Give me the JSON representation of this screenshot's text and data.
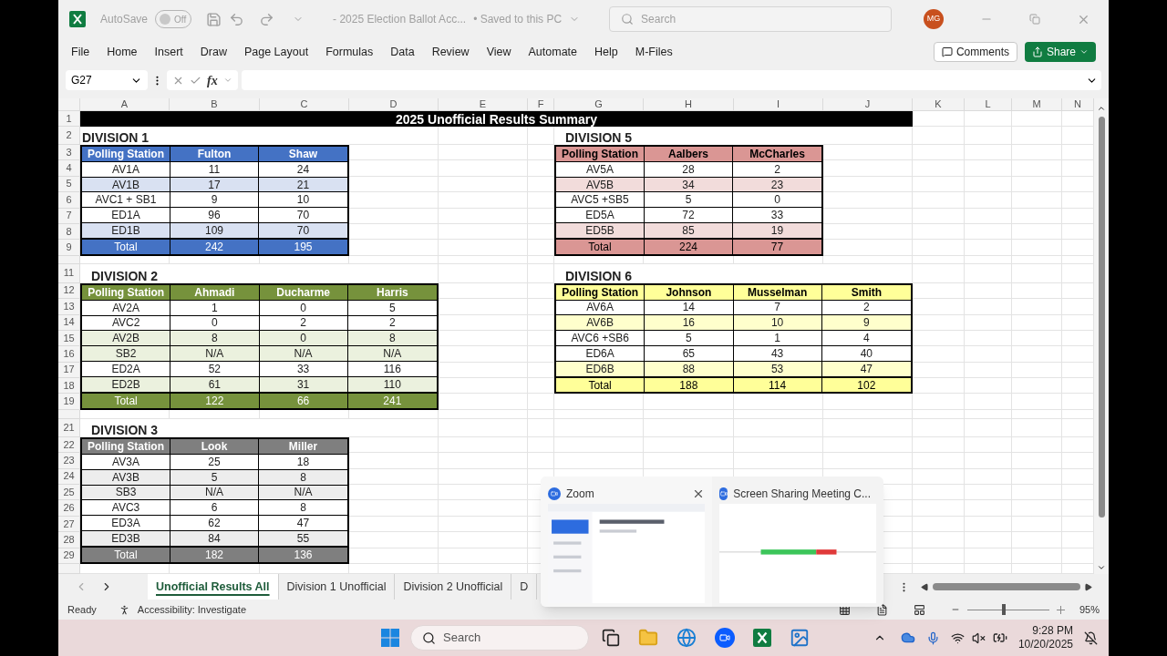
{
  "title_bar": {
    "autosave_label": "AutoSave",
    "autosave": {
      "on": false,
      "label": "Off"
    },
    "document_title": "- 2025 Election Ballot Acc...",
    "save_status": "• Saved to this PC",
    "search_placeholder": "Search",
    "avatar": "MG"
  },
  "ribbon_tabs": [
    "File",
    "Home",
    "Insert",
    "Draw",
    "Page Layout",
    "Formulas",
    "Data",
    "Review",
    "View",
    "Automate",
    "Help",
    "M-Files"
  ],
  "comments_button": "Comments",
  "share_button": "Share",
  "formula_bar": {
    "name_box": "G27",
    "fx": "fx"
  },
  "column_headers": [
    "A",
    "B",
    "C",
    "D",
    "E",
    "F",
    "G",
    "H",
    "I",
    "J",
    "K",
    "L",
    "M",
    "N"
  ],
  "row_numbers": [
    "1",
    "2",
    "3",
    "4",
    "5",
    "6",
    "7",
    "8",
    "9",
    "11",
    "12",
    "13",
    "14",
    "15",
    "16",
    "17",
    "18",
    "19",
    "21",
    "22",
    "23",
    "24",
    "25",
    "26",
    "27",
    "28",
    "29"
  ],
  "banner": "2025 Unofficial Results Summary",
  "divisions": [
    {
      "title": "DIVISION 1",
      "kind": "blue",
      "header": [
        "Polling Station",
        "Fulton",
        "Shaw"
      ],
      "rows": [
        {
          "cells": [
            "AV1A",
            "11",
            "24"
          ],
          "banded": false
        },
        {
          "cells": [
            "AV1B",
            "17",
            "21"
          ],
          "banded": true
        },
        {
          "cells": [
            "AVC1 + SB1",
            "9",
            "10"
          ],
          "banded": false
        },
        {
          "cells": [
            "ED1A",
            "96",
            "70"
          ],
          "banded": false
        },
        {
          "cells": [
            "ED1B",
            "109",
            "70"
          ],
          "banded": true
        }
      ],
      "total": [
        "Total",
        "242",
        "195"
      ]
    },
    {
      "title": "DIVISION 2",
      "kind": "green",
      "header": [
        "Polling Station",
        "Ahmadi",
        "Ducharme",
        "Harris"
      ],
      "rows": [
        {
          "cells": [
            "AV2A",
            "1",
            "0",
            "5"
          ],
          "banded": false
        },
        {
          "cells": [
            "AVC2",
            "0",
            "2",
            "2"
          ],
          "banded": false
        },
        {
          "cells": [
            "AV2B",
            "8",
            "0",
            "8"
          ],
          "banded": true
        },
        {
          "cells": [
            "SB2",
            "N/A",
            "N/A",
            "N/A"
          ],
          "banded": true
        },
        {
          "cells": [
            "ED2A",
            "52",
            "33",
            "116"
          ],
          "banded": false
        },
        {
          "cells": [
            "ED2B",
            "61",
            "31",
            "110"
          ],
          "banded": true
        }
      ],
      "total": [
        "Total",
        "122",
        "66",
        "241"
      ]
    },
    {
      "title": "DIVISION 3",
      "kind": "gray",
      "header": [
        "Polling Station",
        "Look",
        "Miller"
      ],
      "rows": [
        {
          "cells": [
            "AV3A",
            "25",
            "18"
          ],
          "banded": false
        },
        {
          "cells": [
            "AV3B",
            "5",
            "8"
          ],
          "banded": true
        },
        {
          "cells": [
            "SB3",
            "N/A",
            "N/A"
          ],
          "banded": true
        },
        {
          "cells": [
            "AVC3",
            "6",
            "8"
          ],
          "banded": false
        },
        {
          "cells": [
            "ED3A",
            "62",
            "47"
          ],
          "banded": false
        },
        {
          "cells": [
            "ED3B",
            "84",
            "55"
          ],
          "banded": true
        }
      ],
      "total": [
        "Total",
        "182",
        "136"
      ]
    },
    {
      "title": "DIVISION 5",
      "kind": "red",
      "header": [
        "Polling Station",
        "Aalbers",
        "McCharles"
      ],
      "rows": [
        {
          "cells": [
            "AV5A",
            "28",
            "2"
          ],
          "banded": false
        },
        {
          "cells": [
            "AV5B",
            "34",
            "23"
          ],
          "banded": true
        },
        {
          "cells": [
            "AVC5 +SB5",
            "5",
            "0"
          ],
          "banded": false
        },
        {
          "cells": [
            "ED5A",
            "72",
            "33"
          ],
          "banded": false
        },
        {
          "cells": [
            "ED5B",
            "85",
            "19"
          ],
          "banded": true
        }
      ],
      "total": [
        "Total",
        "224",
        "77"
      ]
    },
    {
      "title": "DIVISION 6",
      "kind": "yellow",
      "header": [
        "Polling Station",
        "Johnson",
        "Musselman",
        "Smith"
      ],
      "rows": [
        {
          "cells": [
            "AV6A",
            "14",
            "7",
            "2"
          ],
          "banded": false
        },
        {
          "cells": [
            "AV6B",
            "16",
            "10",
            "9"
          ],
          "banded": true
        },
        {
          "cells": [
            "AVC6 +SB6",
            "5",
            "1",
            "4"
          ],
          "banded": false
        },
        {
          "cells": [
            "ED6A",
            "65",
            "43",
            "40"
          ],
          "banded": false
        },
        {
          "cells": [
            "ED6B",
            "88",
            "53",
            "47"
          ],
          "banded": true
        }
      ],
      "total": [
        "Total",
        "188",
        "114",
        "102"
      ]
    }
  ],
  "sheet_tabs": [
    {
      "label": "Unofficial Results All",
      "selected": true
    },
    {
      "label": "Division 1 Unofficial",
      "selected": false
    },
    {
      "label": "Division 2 Unofficial",
      "selected": false
    },
    {
      "label": "D",
      "selected": false
    }
  ],
  "status_bar": {
    "ready": "Ready",
    "accessibility": "Accessibility: Investigate",
    "zoom_slider": {
      "level": 0.45
    },
    "zoom": "95%"
  },
  "zoom_popup": {
    "windows": [
      "Zoom",
      "Screen Sharing Meeting C..."
    ]
  },
  "taskbar": {
    "search_placeholder": "Search",
    "time": "9:28 PM",
    "date": "10/20/2025"
  }
}
